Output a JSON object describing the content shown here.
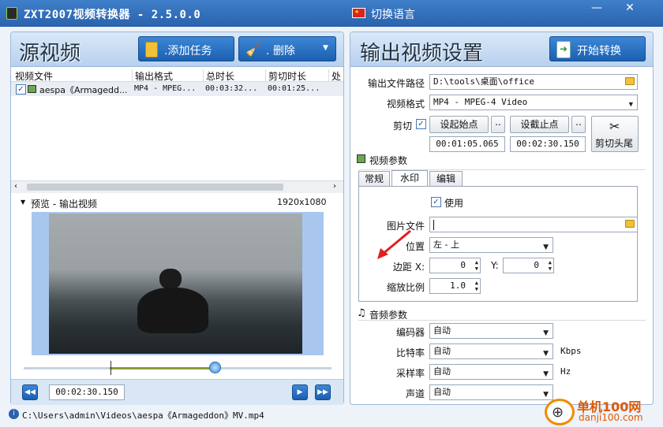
{
  "window": {
    "title": "ZXT2007视频转换器 - 2.5.0.0",
    "language_label": "切换语言",
    "minimize": "—",
    "close": "✕"
  },
  "source": {
    "title": "源视频",
    "add_task_label": ".添加任务",
    "delete_label": ".  删除",
    "columns": [
      "视频文件",
      "输出格式",
      "总时长",
      "剪切时长",
      "处"
    ],
    "rows": [
      {
        "file": "aespa《Armagedd...",
        "format": "MP4 - MPEG...",
        "total": "00:03:32...",
        "cut": "00:01:25..."
      }
    ],
    "preview_label": "预览 - 输出视频",
    "resolution": "1920x1080",
    "time": "00:02:30.150",
    "path": "C:\\Users\\admin\\Videos\\aespa《Armageddon》MV.mp4"
  },
  "output": {
    "title": "输出视频设置",
    "start_label": "开始转换",
    "path_label": "输出文件路径",
    "path_value": "D:\\tools\\桌面\\office",
    "format_label": "视频格式",
    "format_value": "MP4 - MPEG-4 Video",
    "cut_label": "剪切",
    "set_start_label": "设起始点",
    "set_end_label": "设截止点",
    "start_time": "00:01:05.065",
    "end_time": "00:02:30.150",
    "cut_ends_label": "剪切头尾",
    "more": ".."
  },
  "video_params": {
    "title": "视频参数",
    "tabs": [
      "常规",
      "水印",
      "编辑"
    ],
    "use_label": "使用",
    "image_file_label": "图片文件",
    "position_label": "位置",
    "position_value": "左 - 上",
    "margin_label": "边距 X:",
    "margin_x": "0",
    "margin_y_label": "Y:",
    "margin_y": "0",
    "scale_label": "缩放比例",
    "scale_value": "1.0"
  },
  "audio_params": {
    "title": "音频参数",
    "encoder_label": "编码器",
    "encoder_value": "自动",
    "bitrate_label": "比特率",
    "bitrate_value": "自动",
    "bitrate_unit": "Kbps",
    "samplerate_label": "采样率",
    "samplerate_value": "自动",
    "samplerate_unit": "Hz",
    "channel_label": "声道",
    "channel_value": "自动"
  },
  "watermark_site": {
    "name": "单机100网",
    "url": "danji100.com"
  },
  "playback": {
    "position_fraction": 0.62,
    "cut_start_fraction": 0.28
  }
}
